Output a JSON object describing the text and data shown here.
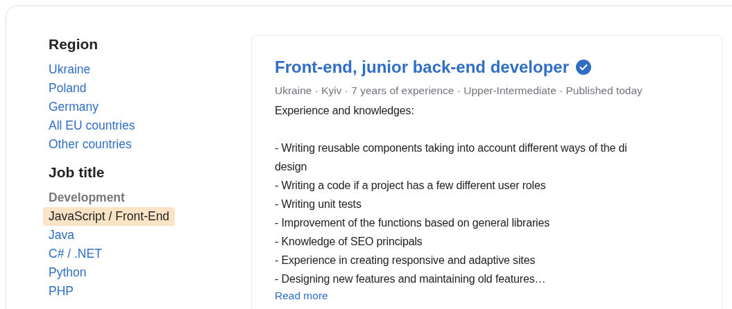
{
  "filters": [
    {
      "heading": "Region",
      "items": [
        {
          "kind": "link",
          "label": "Ukraine",
          "selected": false
        },
        {
          "kind": "link",
          "label": "Poland",
          "selected": false
        },
        {
          "kind": "link",
          "label": "Germany",
          "selected": false
        },
        {
          "kind": "link",
          "label": "All EU countries",
          "selected": false
        },
        {
          "kind": "link",
          "label": "Other countries",
          "selected": false
        }
      ]
    },
    {
      "heading": "Job title",
      "items": [
        {
          "kind": "group",
          "label": "Development"
        },
        {
          "kind": "link",
          "label": "JavaScript / Front-End",
          "selected": true
        },
        {
          "kind": "link",
          "label": "Java",
          "selected": false
        },
        {
          "kind": "link",
          "label": "C# / .NET",
          "selected": false
        },
        {
          "kind": "link",
          "label": "Python",
          "selected": false
        },
        {
          "kind": "link",
          "label": "PHP",
          "selected": false
        }
      ]
    }
  ],
  "job": {
    "title": "Front-end, junior back-end developer",
    "verified": true,
    "meta": "Ukraine · Kyiv · 7 years of experience · Upper-Intermediate · Published today",
    "intro": "Experience and knowledges:",
    "lines": [
      "- Writing reusable components taking into account different ways of the di",
      "design",
      "- Writing a code if a project has a few different user roles",
      "- Writing unit tests",
      "- Improvement of the functions based on general libraries",
      "- Knowledge of SEO principals",
      "- Experience in creating responsive and adaptive sites",
      "- Designing new features and maintaining old features…"
    ],
    "read_more": "Read more"
  }
}
